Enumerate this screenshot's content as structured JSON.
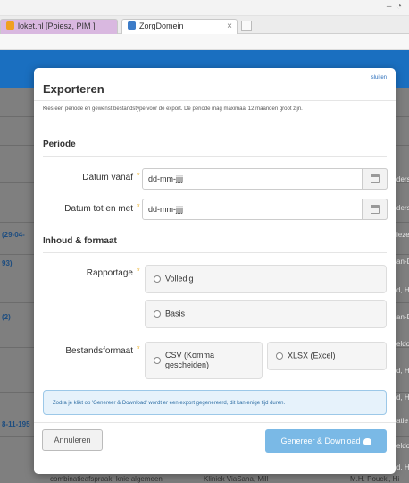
{
  "browser": {
    "tabs": [
      {
        "label": "loket.nl [Poiesz, PIM ]"
      },
      {
        "label": "ZorgDomein"
      }
    ],
    "tab_close": "×"
  },
  "background": {
    "row_texts": [
      "(29-04-",
      "93)",
      "(2)",
      "8-11-195",
      "ders",
      "ders",
      "ieze",
      "an-D",
      "d, Hi",
      "an-D",
      "eldo",
      "d, Hi",
      "d, Hi",
      "atie",
      "eldo",
      "d, Hi",
      "combinatieafspraak, knie algemeen",
      "Kliniek ViaSana, Mill",
      "M.H. Poucki, Hi"
    ]
  },
  "modal": {
    "close_label": "sluiten",
    "title": "Exporteren",
    "intro": "Kies een periode en gewenst bestandstype voor de export. De periode mag maximaal 12 maanden groot zijn.",
    "section_periode": "Periode",
    "date_from_label": "Datum vanaf",
    "date_from_value": "dd-mm-jjjj",
    "date_to_label": "Datum tot en met",
    "date_to_value": "dd-mm-jjjj",
    "required_mark": "*",
    "section_inhoud": "Inhoud & formaat",
    "rapportage_label": "Rapportage",
    "rapportage_options": [
      "Volledig",
      "Basis"
    ],
    "format_label": "Bestandsformaat",
    "format_options": [
      "CSV (Komma gescheiden)",
      "XLSX (Excel)"
    ],
    "info_text": "Zodra je klikt op 'Genereer & Download' wordt er een export gegenereerd, dit kan enige tijd duren.",
    "cancel_label": "Annuleren",
    "generate_label": "Genereer & Download"
  },
  "colors": {
    "primary": "#1a6fc0",
    "button_primary": "#7ab9e6",
    "info_bg": "#e6f2fb",
    "required": "#e6a000"
  }
}
